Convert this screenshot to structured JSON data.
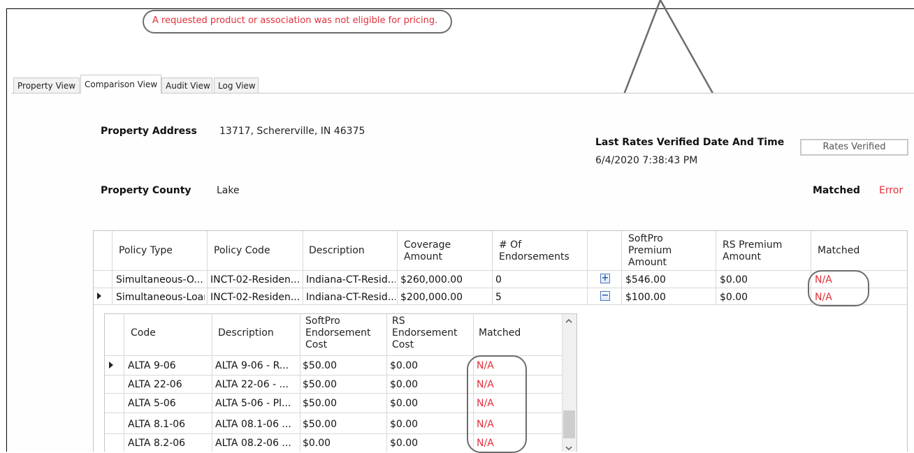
{
  "warning": "A requested product or association was not eligible for pricing.",
  "tabs": [
    {
      "label": "Property View"
    },
    {
      "label": "Comparison View"
    },
    {
      "label": "Audit View"
    },
    {
      "label": "Log View"
    }
  ],
  "property": {
    "address_label": "Property Address",
    "address_value": "13717, Schererville, IN 46375",
    "county_label": "Property County",
    "county_value": "Lake"
  },
  "verification": {
    "label": "Last Rates Verified Date And Time",
    "value": "6/4/2020 7:38:43 PM",
    "button": "Rates Verified",
    "matched_label": "Matched",
    "matched_status": "Error"
  },
  "policy_grid": {
    "headers": {
      "policy_type": "Policy Type",
      "policy_code": "Policy Code",
      "description": "Description",
      "coverage_1": "Coverage",
      "coverage_2": "Amount",
      "endorse_1": "# Of",
      "endorse_2": "Endorsements",
      "softpro_1": "SoftPro",
      "softpro_2": "Premium",
      "softpro_3": "Amount",
      "rs_1": "RS Premium",
      "rs_2": "Amount",
      "matched": "Matched"
    },
    "rows": [
      {
        "policy_type": "Simultaneous-O...",
        "policy_code": "INCT-02-Residen...",
        "description": "Indiana-CT-Resid...",
        "coverage": "$260,000.00",
        "endorsements": "0",
        "expander": "+",
        "softpro": "$546.00",
        "rs": "$0.00",
        "matched": "N/A"
      },
      {
        "policy_type": "Simultaneous-Loan",
        "policy_code": "INCT-02-Residen...",
        "description": "Indiana-CT-Resid...",
        "coverage": "$200,000.00",
        "endorsements": "5",
        "expander": "−",
        "softpro": "$100.00",
        "rs": "$0.00",
        "matched": "N/A"
      }
    ]
  },
  "endorsement_grid": {
    "headers": {
      "code": "Code",
      "description": "Description",
      "softpro_1": "SoftPro",
      "softpro_2": "Endorsement",
      "softpro_3": "Cost",
      "rs_1": "RS",
      "rs_2": "Endorsement",
      "rs_3": "Cost",
      "matched": "Matched"
    },
    "rows": [
      {
        "code": "ALTA 9-06",
        "description": "ALTA 9-06 - R...",
        "softpro": "$50.00",
        "rs": "$0.00",
        "matched": "N/A"
      },
      {
        "code": "ALTA 22-06",
        "description": "ALTA 22-06 - ...",
        "softpro": "$50.00",
        "rs": "$0.00",
        "matched": "N/A"
      },
      {
        "code": "ALTA 5-06",
        "description": "ALTA 5-06 - Pl...",
        "softpro": "$50.00",
        "rs": "$0.00",
        "matched": "N/A"
      },
      {
        "code": "ALTA 8.1-06",
        "description": "ALTA 08.1-06 ...",
        "softpro": "$50.00",
        "rs": "$0.00",
        "matched": "N/A"
      },
      {
        "code": "ALTA 8.2-06",
        "description": "ALTA 08.2-06 ...",
        "softpro": "$0.00",
        "rs": "$0.00",
        "matched": "N/A"
      }
    ]
  },
  "icons": {
    "row_selector": "row-selector-icon",
    "expand": "plus-icon",
    "collapse": "minus-icon",
    "scroll_up": "chevron-up-icon",
    "scroll_down": "chevron-down-icon"
  },
  "colors": {
    "error": "#e0303a",
    "annotation": "#6c6c6c"
  }
}
